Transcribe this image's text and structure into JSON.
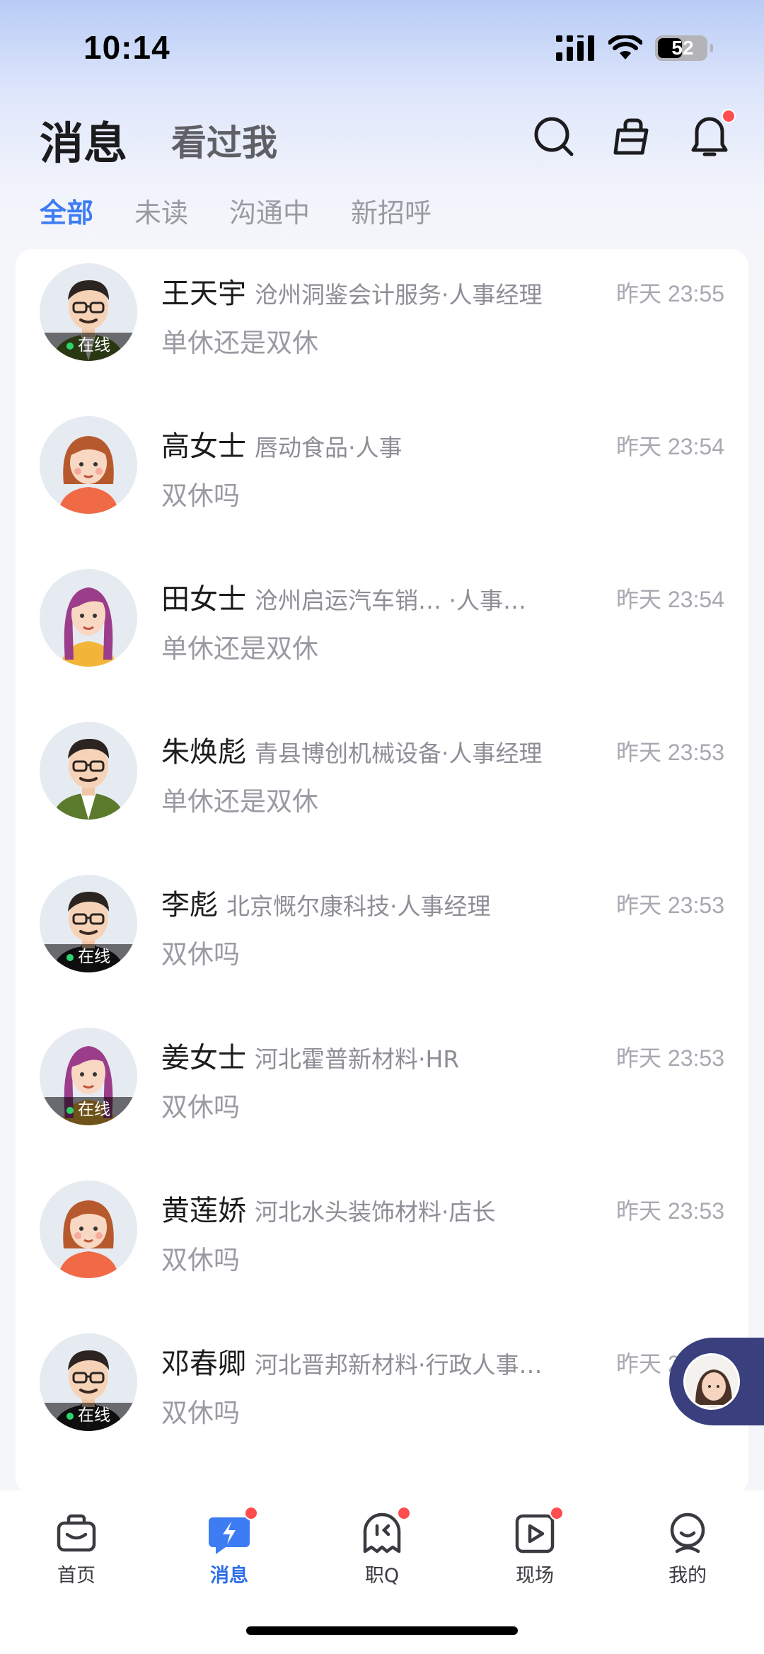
{
  "status_bar": {
    "time": "10:14",
    "battery": "52",
    "battery_level_pct": 52
  },
  "header": {
    "title": "消息",
    "subtitle": "看过我",
    "icons": [
      "search-icon",
      "briefcase-icon",
      "bell-icon"
    ]
  },
  "filters": {
    "all": "全部",
    "unread": "未读",
    "communicating": "沟通中",
    "new_greeting": "新招呼"
  },
  "online_label": "在线",
  "conversations": [
    {
      "name": "王天宇",
      "company": "沧州洞鉴会计服务·人事经理",
      "time_day": "昨天",
      "time": "23:55",
      "message": "单休还是双休",
      "online": true,
      "avatar": "male-glasses-green"
    },
    {
      "name": "高女士",
      "company": "唇动食品·人事",
      "time_day": "昨天",
      "time": "23:54",
      "message": "双休吗",
      "online": false,
      "avatar": "female-bob-orange"
    },
    {
      "name": "田女士",
      "company": "沧州启运汽车销… ·人事…",
      "time_day": "昨天",
      "time": "23:54",
      "message": "单休还是双休",
      "online": false,
      "avatar": "female-long-purple"
    },
    {
      "name": "朱焕彪",
      "company": "青县博创机械设备·人事经理",
      "time_day": "昨天",
      "time": "23:53",
      "message": "单休还是双休",
      "online": false,
      "avatar": "male-glasses-green"
    },
    {
      "name": "李彪",
      "company": "北京慨尔康科技·人事经理",
      "time_day": "昨天",
      "time": "23:53",
      "message": "双休吗",
      "online": true,
      "avatar": "male-glasses-black"
    },
    {
      "name": "姜女士",
      "company": "河北霍普新材料·HR",
      "time_day": "昨天",
      "time": "23:53",
      "message": "双休吗",
      "online": true,
      "avatar": "female-long-purple"
    },
    {
      "name": "黄莲娇",
      "company": "河北水头装饰材料·店长",
      "time_day": "昨天",
      "time": "23:53",
      "message": "双休吗",
      "online": false,
      "avatar": "female-bob-orange"
    },
    {
      "name": "邓春卿",
      "company": "河北晋邦新材料·行政人事…",
      "time_day": "昨天",
      "time": "23:53",
      "message": "双休吗",
      "online": true,
      "avatar": "male-glasses-black"
    }
  ],
  "tabbar": {
    "home": "首页",
    "messages": "消息",
    "zhiq": "职Q",
    "live": "现场",
    "mine": "我的"
  },
  "colors": {
    "accent": "#3d7cf2",
    "badge": "#ff4d4f",
    "online": "#2fd36b"
  }
}
